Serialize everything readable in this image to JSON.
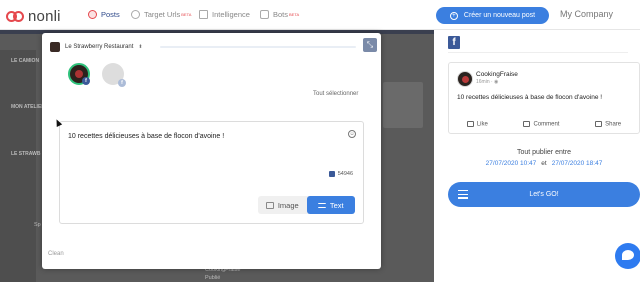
{
  "brand": {
    "name": "nonli"
  },
  "nav": {
    "items": [
      {
        "label": "Posts",
        "badge": ""
      },
      {
        "label": "Target Urls",
        "badge": "BETA"
      },
      {
        "label": "Intelligence",
        "badge": ""
      },
      {
        "label": "Bots",
        "badge": "BETA"
      }
    ],
    "create_label": "Créer un nouveau post",
    "company": "My Company"
  },
  "background": {
    "side_labels": [
      "LE CAMION",
      "MON ATELIER",
      "LE STRAWB"
    ],
    "bottom_left": "Sp",
    "bottom_mid": "CookingFraise",
    "bottom_mid_sub": "Publié"
  },
  "modal": {
    "page_name": "Le Strawberry Restaurant",
    "select_all": "Tout sélectionner",
    "post_text": "10 recettes délicieuses à base de flocon d'avoine !",
    "char_count": "54946",
    "mode_image": "Image",
    "mode_text": "Text",
    "active_mode": "Text",
    "clean": "Clean",
    "collapse_glyph": "⤡"
  },
  "preview": {
    "network": "f",
    "author": "CookingFraise",
    "time": "16min · ◉",
    "text": "10 recettes délicieuses à base de flocon d'avoine !",
    "actions": [
      "Like",
      "Comment",
      "Share"
    ]
  },
  "publish": {
    "title": "Tout publier entre",
    "start": "27/07/2020 10:47",
    "and": "et",
    "end": "27/07/2020 18:47",
    "go_label": "Let's GO!"
  },
  "colors": {
    "accent": "#3b7fe0",
    "brand_red": "#e5484d",
    "facebook": "#3b5998",
    "overlay": "#5a5a5a"
  }
}
